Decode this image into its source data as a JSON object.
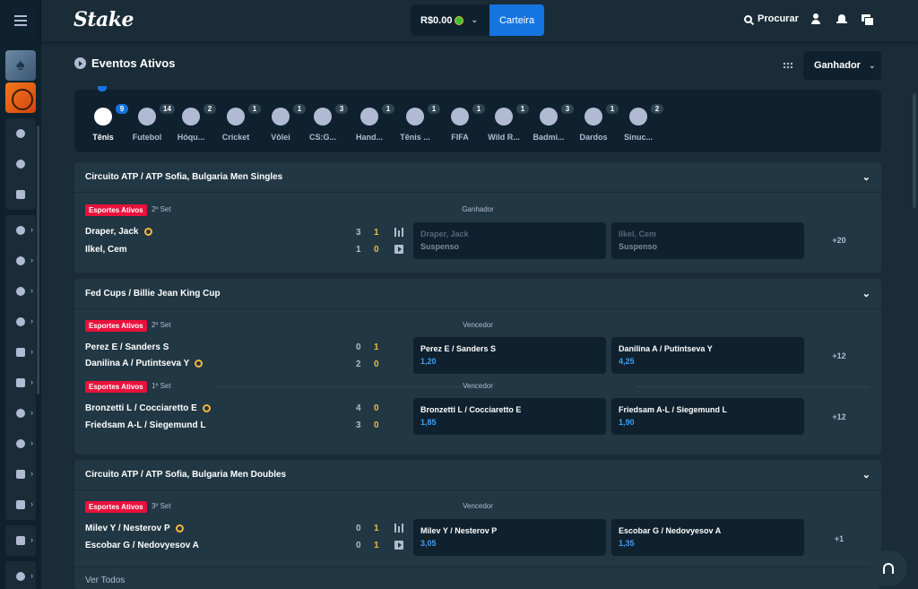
{
  "brand": "Stake",
  "header": {
    "balance": "R$0.00",
    "wallet_label": "Carteira",
    "search_label": "Procurar"
  },
  "section": {
    "title": "Eventos Ativos",
    "market_select": "Ganhador"
  },
  "sports": [
    {
      "name": "Tênis",
      "count": "9",
      "active": true
    },
    {
      "name": "Futebol",
      "count": "14"
    },
    {
      "name": "Hóqu...",
      "count": "2"
    },
    {
      "name": "Cricket",
      "count": "1"
    },
    {
      "name": "Vôlei",
      "count": "1"
    },
    {
      "name": "CS:G...",
      "count": "3"
    },
    {
      "name": "Hand...",
      "count": "1"
    },
    {
      "name": "Tênis ...",
      "count": "1"
    },
    {
      "name": "FIFA",
      "count": "1"
    },
    {
      "name": "Wild R...",
      "count": "1"
    },
    {
      "name": "Badmi...",
      "count": "3"
    },
    {
      "name": "Dardos",
      "count": "1"
    },
    {
      "name": "Sinuc...",
      "count": "2"
    }
  ],
  "blocks": [
    {
      "title": "Circuito ATP / ATP Sofia, Bulgaria Men Singles",
      "events": [
        {
          "live_tag": "Esportes Ativos",
          "set": "2º Set",
          "market": "Ganhador",
          "team1": "Draper, Jack",
          "team2": "Ilkel, Cem",
          "team1_sets": "3",
          "team1_games": "1",
          "team2_sets": "1",
          "team2_games": "0",
          "odd1_name": "Draper, Jack",
          "odd1_value": "Suspenso",
          "odd2_name": "Ilkel, Cem",
          "odd2_value": "Suspenso",
          "more": "+20"
        }
      ]
    },
    {
      "title": "Fed Cups / Billie Jean King Cup",
      "events": [
        {
          "live_tag": "Esportes Ativos",
          "set": "2º Set",
          "market": "Vencedor",
          "team1": "Perez E / Sanders S",
          "team2": "Danilina A / Putintseva Y",
          "team1_sets": "0",
          "team1_games": "1",
          "team2_sets": "2",
          "team2_games": "0",
          "odd1_name": "Perez E / Sanders S",
          "odd1_value": "1,20",
          "odd2_name": "Danilina A / Putintseva Y",
          "odd2_value": "4,25",
          "more": "+12"
        },
        {
          "live_tag": "Esportes Ativos",
          "set": "1º Set",
          "market": "Vencedor",
          "team1": "Bronzetti L / Cocciaretto E",
          "team2": "Friedsam A-L / Siegemund L",
          "team1_sets": "4",
          "team1_games": "0",
          "team2_sets": "3",
          "team2_games": "0",
          "odd1_name": "Bronzetti L / Cocciaretto E",
          "odd1_value": "1,85",
          "odd2_name": "Friedsam A-L / Siegemund L",
          "odd2_value": "1,90",
          "more": "+12"
        }
      ]
    },
    {
      "title": "Circuito ATP / ATP Sofia, Bulgaria Men Doubles",
      "events": [
        {
          "live_tag": "Esportes Ativos",
          "set": "3º Set",
          "market": "Vencedor",
          "team1": "Milev Y / Nesterov P",
          "team2": "Escobar G / Nedovyesov A",
          "team1_sets": "0",
          "team1_games": "1",
          "team2_sets": "0",
          "team2_games": "1",
          "odd1_name": "Milev Y / Nesterov P",
          "odd1_value": "3,05",
          "odd2_name": "Escobar G / Nedovyesov A",
          "odd2_value": "1,35",
          "more": "+1"
        }
      ]
    }
  ],
  "see_all": "Ver Todos",
  "colors": {
    "bg": "#1a2c38",
    "panel": "#213743",
    "dark": "#0f212e",
    "accent": "#1475e1",
    "live": "#e9113c",
    "odds": "#3e9ff2",
    "score_highlight": "#f6b73c"
  }
}
